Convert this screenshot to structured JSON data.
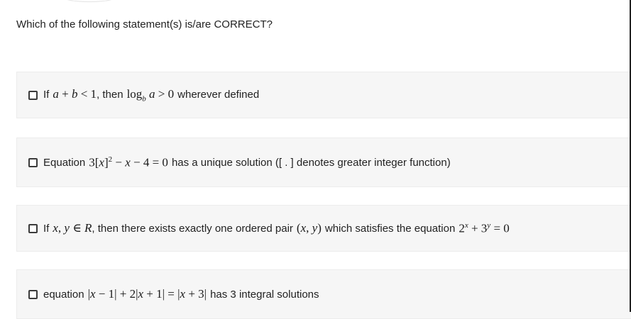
{
  "question": {
    "text": "Which of the following statement(s) is/are CORRECT?"
  },
  "options": [
    {
      "before": "If",
      "math1": "a + b < 1",
      "mid": ", then",
      "math2": "log_b a > 0",
      "after": "wherever defined",
      "checked": false
    },
    {
      "before": "Equation",
      "math1": "3[x]^2 − x − 4 = 0",
      "after": "has a unique solution ([ . ] denotes greater integer function)",
      "checked": false
    },
    {
      "before": "If",
      "math1": "x, y ∈ R",
      "mid": ", then there exists exactly one ordered pair",
      "math2": "(x, y)",
      "after": "which satisfies the equation",
      "math3": "2^x + 3^y = 0",
      "checked": false
    },
    {
      "before": "equation",
      "math1": "|x − 1| + 2|x + 1| = |x + 3|",
      "after": "has 3 integral solutions",
      "checked": false
    }
  ]
}
